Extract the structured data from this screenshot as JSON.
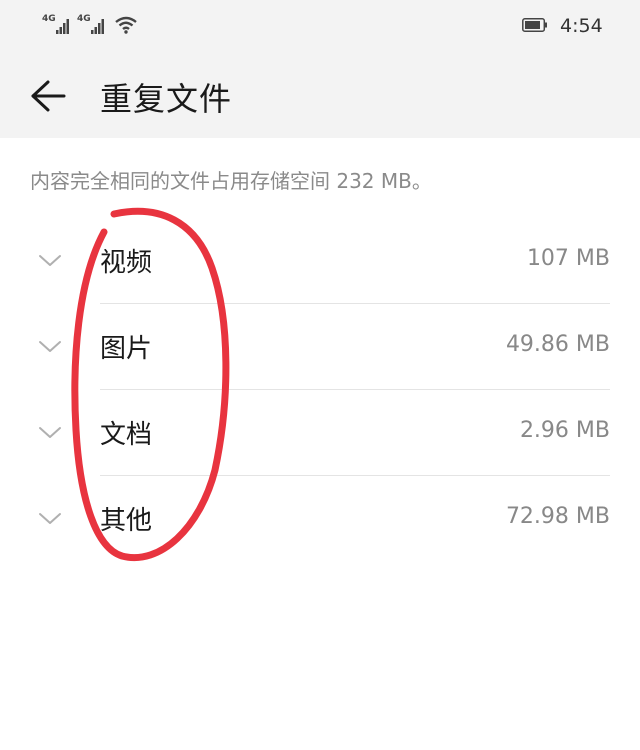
{
  "status_bar": {
    "sim1_label": "4G",
    "sim2_label": "4G",
    "time": "4:54",
    "icons": [
      "signal-icon",
      "signal-icon",
      "wifi-icon",
      "battery-icon"
    ]
  },
  "header": {
    "title": "重复文件",
    "back_icon": "back-arrow-icon"
  },
  "summary": "内容完全相同的文件占用存储空间 232 MB。",
  "categories": [
    {
      "label": "视频",
      "size": "107 MB"
    },
    {
      "label": "图片",
      "size": "49.86 MB"
    },
    {
      "label": "文档",
      "size": "2.96 MB"
    },
    {
      "label": "其他",
      "size": "72.98 MB"
    }
  ],
  "colors": {
    "bar_bg": "#f3f3f3",
    "annotation": "#e8343f",
    "secondary_text": "#888888"
  }
}
